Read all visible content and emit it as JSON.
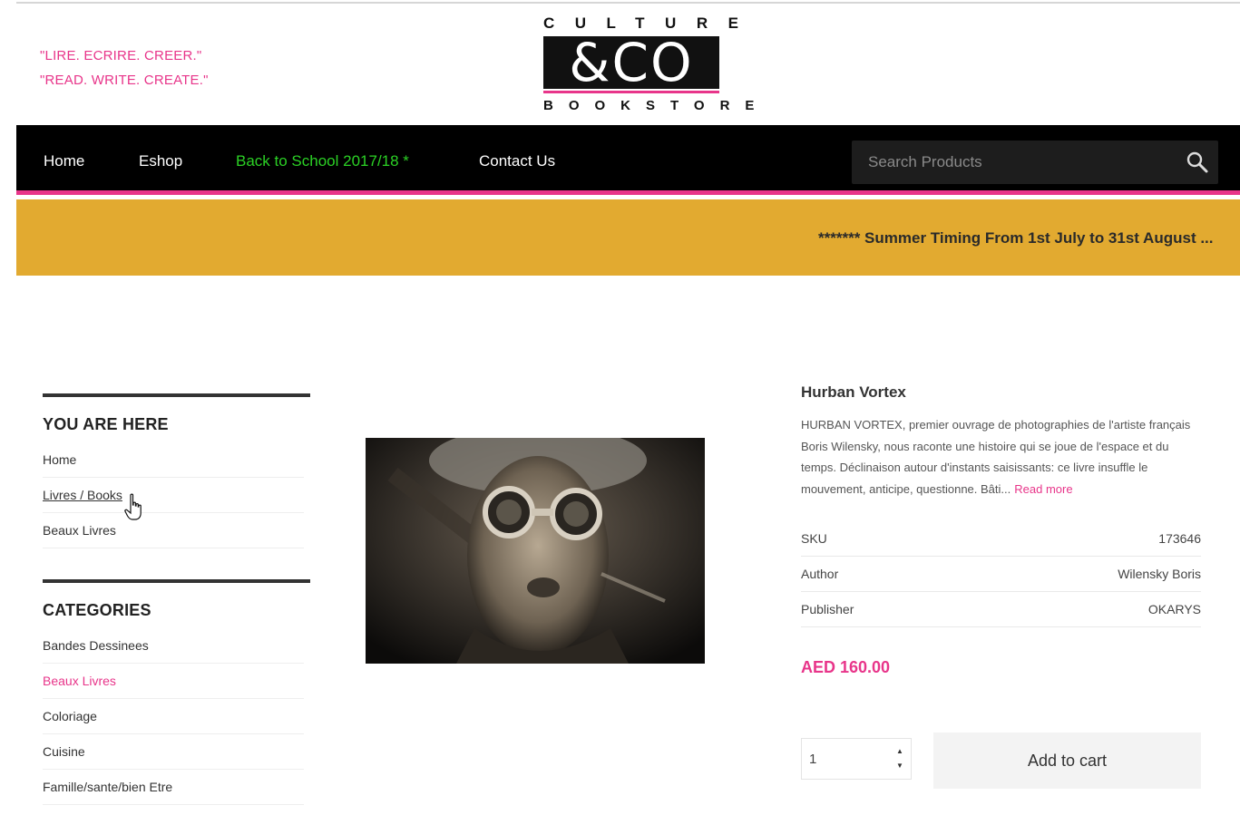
{
  "header": {
    "tagline_fr": "\"LIRE. ECRIRE. CREER.\"",
    "tagline_en": "\"READ. WRITE. CREATE.\"",
    "logo": {
      "top": "CULTURE",
      "main": "&CO",
      "bottom": "BOOKSTORE"
    }
  },
  "nav": {
    "items": [
      {
        "label": "Home"
      },
      {
        "label": "Eshop"
      },
      {
        "label": "Back to School 2017/18 *"
      },
      {
        "label": "Contact Us"
      }
    ],
    "search": {
      "placeholder": "Search Products",
      "icon": "magnifier-icon"
    },
    "highlight_color": "#2bd125",
    "accent_color": "#e8358a"
  },
  "announcement": {
    "text": "******* Summer Timing From 1st July to 31st August ..."
  },
  "sidebar": {
    "breadcrumb_title": "YOU ARE HERE",
    "breadcrumb": [
      {
        "label": "Home"
      },
      {
        "label": "Livres / Books"
      },
      {
        "label": "Beaux Livres"
      }
    ],
    "categories_title": "CATEGORIES",
    "categories": [
      {
        "label": "Bandes Dessinees"
      },
      {
        "label": "Beaux Livres"
      },
      {
        "label": "Coloriage"
      },
      {
        "label": "Cuisine"
      },
      {
        "label": "Famille/sante/bien Etre"
      }
    ]
  },
  "product": {
    "title": "Hurban Vortex",
    "description": "HURBAN VORTEX, premier ouvrage de photographies de l'artiste français Boris Wilensky, nous raconte une histoire qui se joue de l'espace et du temps. Déclinaison autour d'instants saisissants: ce livre insuffle le mouvement, anticipe, questionne. Bâti...",
    "read_more": "Read more",
    "meta": [
      {
        "label": "SKU",
        "value": "173646"
      },
      {
        "label": "Author",
        "value": "Wilensky Boris"
      },
      {
        "label": "Publisher",
        "value": "OKARYS"
      }
    ],
    "price": "AED 160.00",
    "quantity": "1",
    "add_to_cart": "Add to cart",
    "image_alt": "portrait-with-goggles-photo"
  }
}
